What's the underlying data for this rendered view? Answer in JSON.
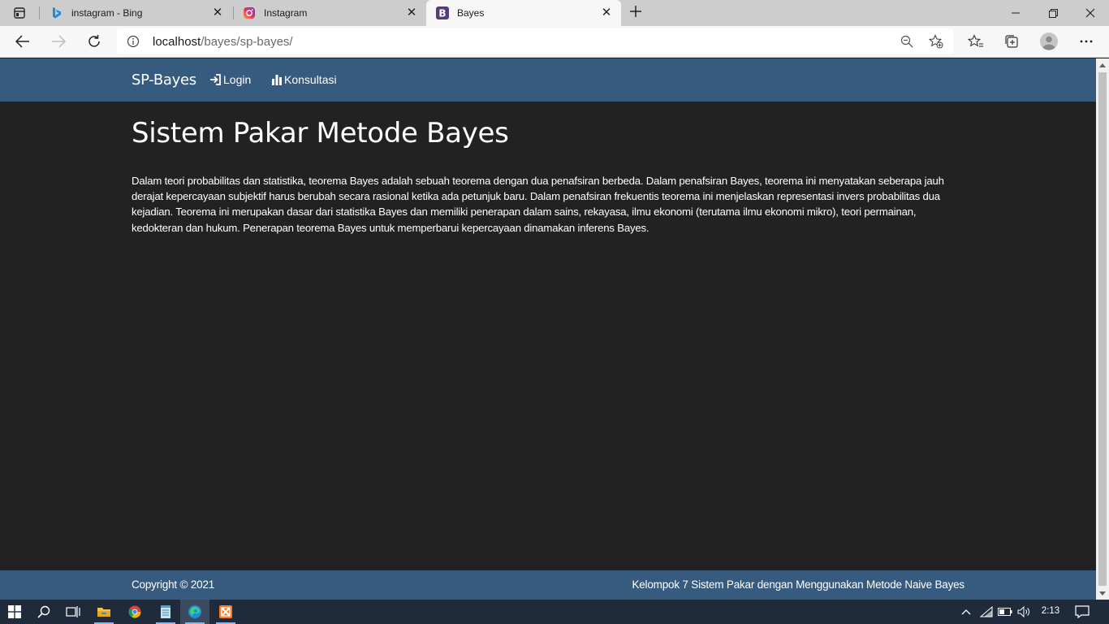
{
  "browser": {
    "tabs": [
      {
        "title": "instagram - Bing",
        "favicon": "bing-icon",
        "active": false
      },
      {
        "title": "Instagram",
        "favicon": "instagram-icon",
        "active": false
      },
      {
        "title": "Bayes",
        "favicon": "bootstrap-icon",
        "active": true
      }
    ],
    "address": {
      "host": "localhost",
      "path": "/bayes/sp-bayes/"
    }
  },
  "navbar": {
    "brand": "SP-Bayes",
    "links": [
      {
        "label": "Login",
        "icon": "login-icon"
      },
      {
        "label": "Konsultasi",
        "icon": "bar-chart-icon"
      }
    ]
  },
  "main": {
    "title": "Sistem Pakar Metode Bayes",
    "paragraph": "Dalam teori probabilitas dan statistika, teorema Bayes adalah sebuah teorema dengan dua penafsiran berbeda. Dalam penafsiran Bayes, teorema ini menyatakan seberapa jauh derajat kepercayaan subjektif harus berubah secara rasional ketika ada petunjuk baru. Dalam penafsiran frekuentis teorema ini menjelaskan representasi invers probabilitas dua kejadian. Teorema ini merupakan dasar dari statistika Bayes dan memiliki penerapan dalam sains, rekayasa, ilmu ekonomi (terutama ilmu ekonomi mikro), teori permainan, kedokteran dan hukum. Penerapan teorema Bayes untuk memperbarui kepercayaan dinamakan inferens Bayes."
  },
  "footer": {
    "copyright": "Copyright © 2021",
    "credit": "Kelompok 7 Sistem Pakar dengan Menggunakan Metode Naive Bayes"
  },
  "taskbar": {
    "clock": "2:13",
    "apps": [
      "windows-start-icon",
      "search-icon",
      "task-view-icon",
      "file-explorer-icon",
      "chrome-icon",
      "notepad-icon",
      "edge-icon",
      "xampp-icon"
    ]
  },
  "colors": {
    "navbar": "#375a7f",
    "page_background": "#222222"
  }
}
